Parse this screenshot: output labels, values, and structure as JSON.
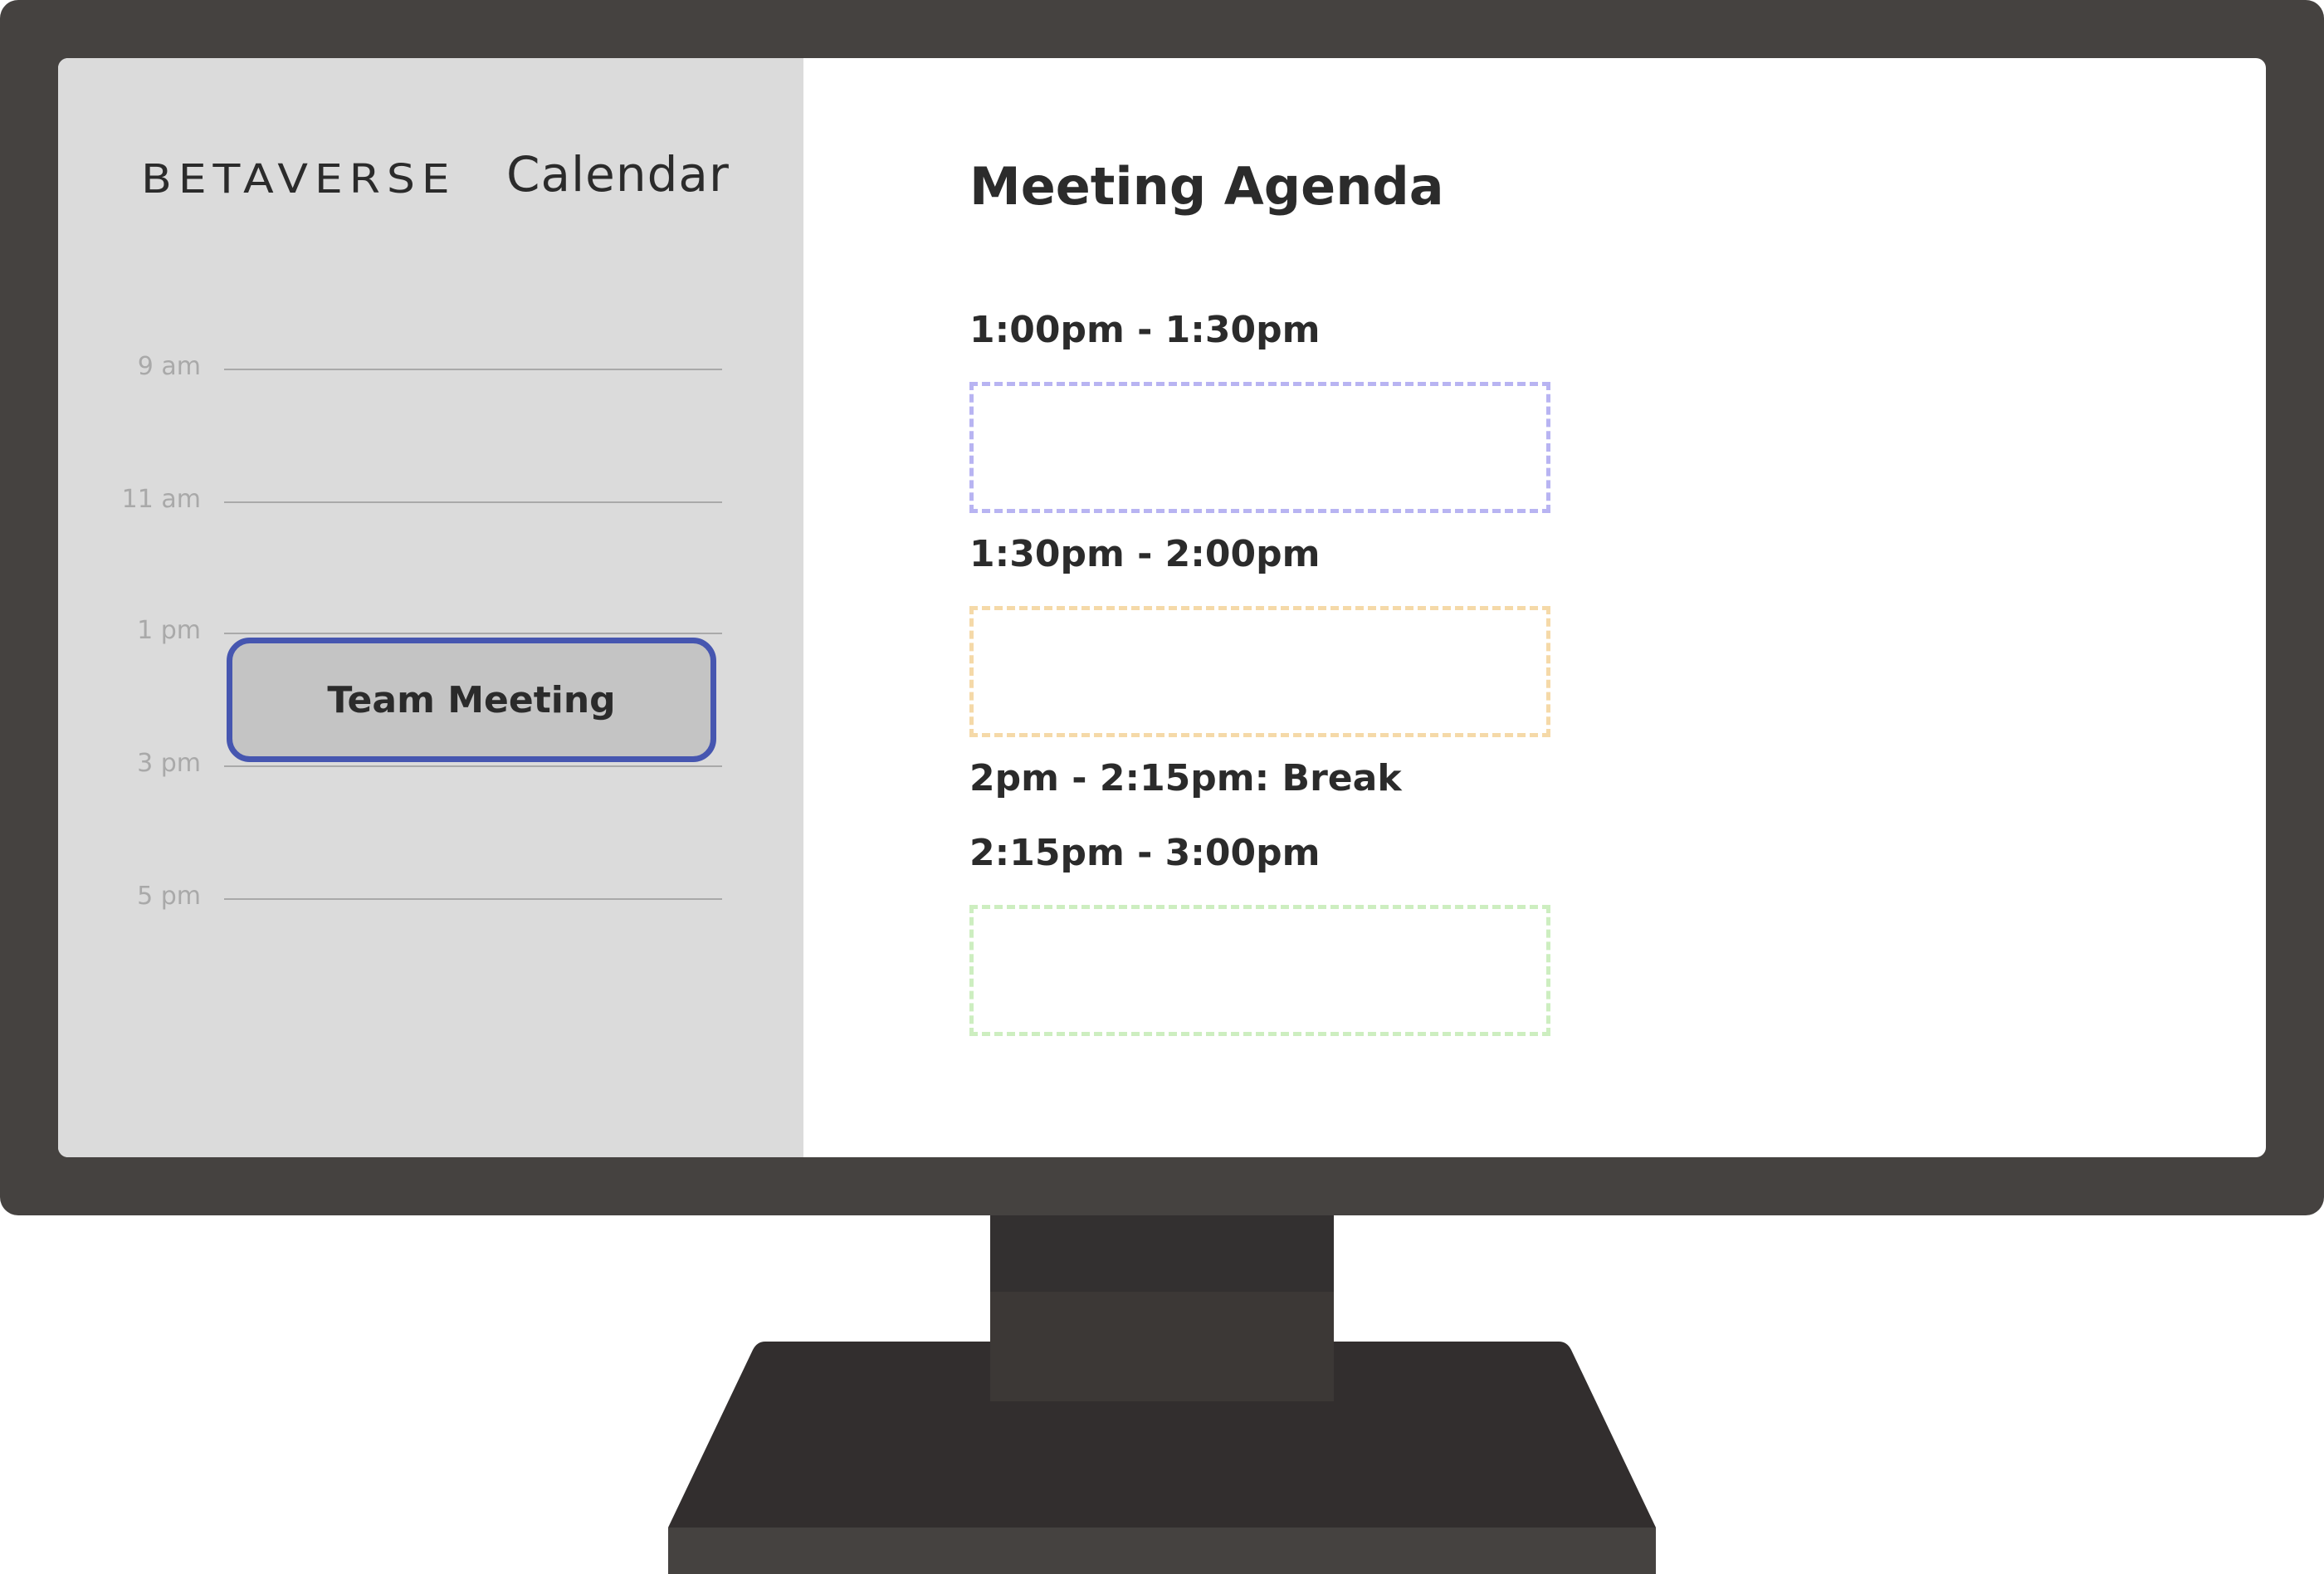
{
  "colors": {
    "bezel": "#454240",
    "sidebar_bg": "#dbdbdb",
    "event_fill": "#c4c4c4",
    "event_border": "#4656b0",
    "text_dark": "#2b2b2b",
    "text_muted": "#a9a9a9",
    "slot_purple": "#b8b4f2",
    "slot_orange": "#f5d9a8",
    "slot_green": "#cdeec0"
  },
  "sidebar": {
    "brand": "BETAVERSE",
    "app_name": "Calendar",
    "hours": [
      "9 am",
      "11 am",
      "1 pm",
      "3 pm",
      "5 pm"
    ],
    "event": {
      "label": "Team Meeting"
    }
  },
  "agenda": {
    "title": "Meeting Agenda",
    "slots": [
      {
        "time": "1:00pm - 1:30pm",
        "color": "#b8b4f2",
        "has_box": true
      },
      {
        "time": "1:30pm - 2:00pm",
        "color": "#f5d9a8",
        "has_box": true
      },
      {
        "time": "2pm - 2:15pm: Break",
        "has_box": false
      },
      {
        "time": "2:15pm - 3:00pm",
        "color": "#cdeec0",
        "has_box": true
      }
    ]
  }
}
